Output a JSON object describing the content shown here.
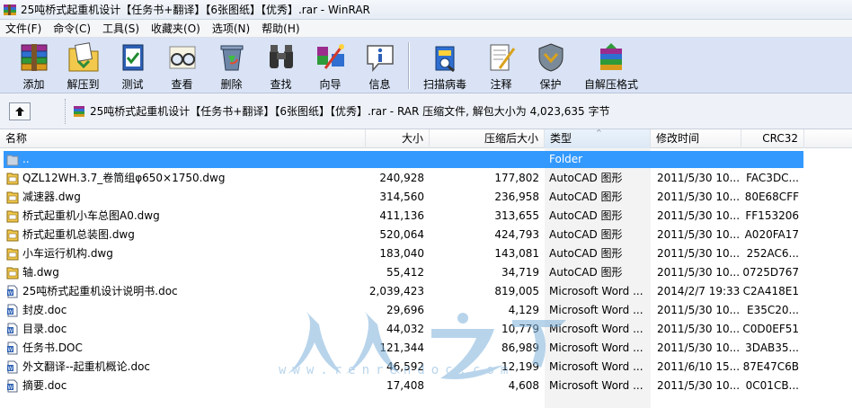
{
  "window": {
    "title": "25吨桥式起重机设计【任务书+翻译】【6张图纸】【优秀】.rar - WinRAR"
  },
  "menu": [
    "文件(F)",
    "命令(C)",
    "工具(S)",
    "收藏夹(O)",
    "选项(N)",
    "帮助(H)"
  ],
  "toolbar": {
    "add": "添加",
    "extract": "解压到",
    "test": "测试",
    "view": "查看",
    "delete": "删除",
    "find": "查找",
    "wizard": "向导",
    "info": "信息",
    "virus_scan": "扫描病毒",
    "comment": "注释",
    "protect": "保护",
    "sfx": "自解压格式"
  },
  "address": {
    "text": "25吨桥式起重机设计【任务书+翻译】【6张图纸】【优秀】.rar - RAR 压缩文件, 解包大小为 4,023,635 字节"
  },
  "columns": {
    "name": "名称",
    "size": "大小",
    "packed": "压缩后大小",
    "type": "类型",
    "modified": "修改时间",
    "crc": "CRC32"
  },
  "rows": [
    {
      "icon": "folder-up-icon",
      "name": "..",
      "size": "",
      "packed": "",
      "type": "Folder",
      "modified": "",
      "crc": ""
    },
    {
      "icon": "dwg-file-icon",
      "name": "QZL12WH.3.7_卷筒组φ650×1750.dwg",
      "size": "240,928",
      "packed": "177,802",
      "type": "AutoCAD 图形",
      "modified": "2011/5/30 10...",
      "crc": "FAC3DC..."
    },
    {
      "icon": "dwg-file-icon",
      "name": "减速器.dwg",
      "size": "314,560",
      "packed": "236,958",
      "type": "AutoCAD 图形",
      "modified": "2011/5/30 10...",
      "crc": "80E68CFF"
    },
    {
      "icon": "dwg-file-icon",
      "name": "桥式起重机小车总图A0.dwg",
      "size": "411,136",
      "packed": "313,655",
      "type": "AutoCAD 图形",
      "modified": "2011/5/30 10...",
      "crc": "FF153206"
    },
    {
      "icon": "dwg-file-icon",
      "name": "桥式起重机总装图.dwg",
      "size": "520,064",
      "packed": "424,793",
      "type": "AutoCAD 图形",
      "modified": "2011/5/30 10...",
      "crc": "A020FA17"
    },
    {
      "icon": "dwg-file-icon",
      "name": "小车运行机构.dwg",
      "size": "183,040",
      "packed": "143,081",
      "type": "AutoCAD 图形",
      "modified": "2011/5/30 10...",
      "crc": "252AC6..."
    },
    {
      "icon": "dwg-file-icon",
      "name": "轴.dwg",
      "size": "55,412",
      "packed": "34,719",
      "type": "AutoCAD 图形",
      "modified": "2011/5/30 10...",
      "crc": "0725D767"
    },
    {
      "icon": "doc-file-icon",
      "name": "25吨桥式起重机设计说明书.doc",
      "size": "2,039,423",
      "packed": "819,005",
      "type": "Microsoft Word ...",
      "modified": "2014/2/7 19:33",
      "crc": "C2A418E1"
    },
    {
      "icon": "doc-file-icon",
      "name": "封皮.doc",
      "size": "29,696",
      "packed": "4,129",
      "type": "Microsoft Word ...",
      "modified": "2011/5/30 10...",
      "crc": "E35C20..."
    },
    {
      "icon": "doc-file-icon",
      "name": "目录.doc",
      "size": "44,032",
      "packed": "10,779",
      "type": "Microsoft Word ...",
      "modified": "2011/5/30 10...",
      "crc": "C0D0EF51"
    },
    {
      "icon": "doc-file-icon",
      "name": "任务书.DOC",
      "size": "121,344",
      "packed": "86,989",
      "type": "Microsoft Word ...",
      "modified": "2011/5/30 10...",
      "crc": "3DAB35..."
    },
    {
      "icon": "doc-file-icon",
      "name": "外文翻译--起重机概论.doc",
      "size": "46,592",
      "packed": "12,199",
      "type": "Microsoft Word ...",
      "modified": "2011/6/10 15...",
      "crc": "87E47C6B"
    },
    {
      "icon": "doc-file-icon",
      "name": "摘要.doc",
      "size": "17,408",
      "packed": "4,608",
      "type": "Microsoft Word ...",
      "modified": "2011/5/30 10...",
      "crc": "0C01CB..."
    }
  ],
  "watermark": {
    "text": "www.renrendoc.com"
  },
  "colors": {
    "selection": "#3399ff",
    "toolbar": "#d9e3f5",
    "type_column": "#f3f3f3"
  }
}
